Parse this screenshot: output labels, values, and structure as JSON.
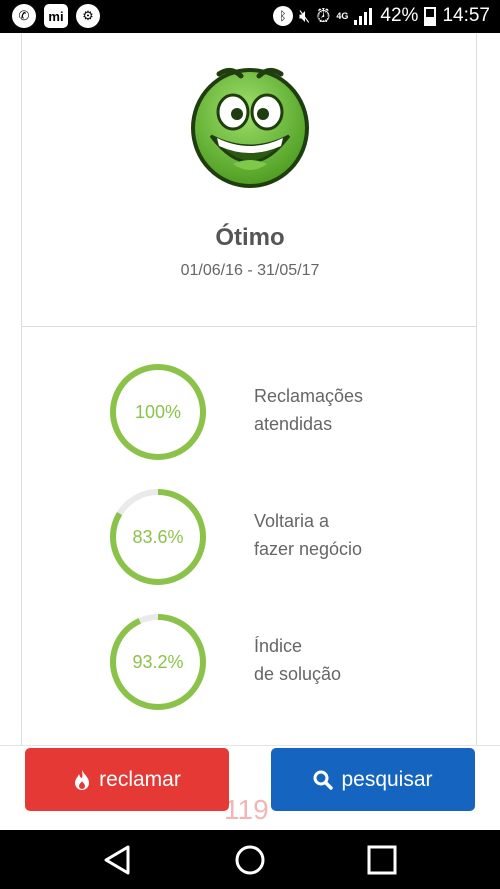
{
  "status_bar": {
    "battery": "42%",
    "time": "14:57",
    "network": "4G"
  },
  "rating": {
    "title": "Ótimo",
    "period": "01/06/16 - 31/05/17",
    "face_color": "#6abf3b"
  },
  "stats": [
    {
      "value_text": "100%",
      "value": 100,
      "label_line1": "Reclamações",
      "label_line2": "atendidas"
    },
    {
      "value_text": "83.6%",
      "value": 83.6,
      "label_line1": "Voltaria a",
      "label_line2": "fazer negócio"
    },
    {
      "value_text": "93.2%",
      "value": 93.2,
      "label_line1": "Índice",
      "label_line2": "de solução"
    }
  ],
  "actions": {
    "complain_label": "reclamar",
    "search_label": "pesquisar",
    "ghost_text": "119"
  },
  "colors": {
    "ring": "#8bc34a",
    "complain": "#e53935",
    "search": "#1565c0"
  },
  "icons": [
    "whatsapp-icon",
    "mi-icon",
    "android-icon",
    "bluetooth-icon",
    "mute-icon",
    "alarm-icon",
    "signal-icon",
    "battery-icon",
    "fire-icon",
    "search-icon",
    "back-icon",
    "home-icon",
    "recents-icon"
  ]
}
